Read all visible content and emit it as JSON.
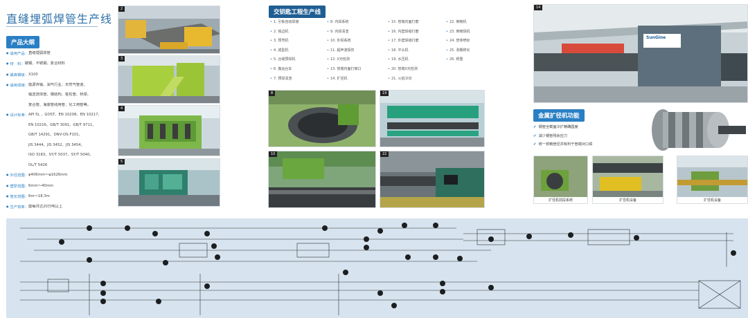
{
  "header": {
    "title": "直缝埋弧焊管生产线"
  },
  "product_overview": {
    "heading": "产品大纲",
    "specs": [
      {
        "label": "适用产品：",
        "lines": [
          "直缝埋弧焊管"
        ]
      },
      {
        "label": "材　料：",
        "lines": [
          "碳钢、不锈钢、复合材料"
        ]
      },
      {
        "label": "最高钢级：",
        "lines": [
          "X100"
        ]
      },
      {
        "label": "适用领域：",
        "lines": [
          "能源传输、油气行业、天然气管道、",
          "输送流体管、钢结构、桩柱管、桥梁、",
          "复合管、海底管线用管、化工用管等。"
        ]
      },
      {
        "label": "设计标准：",
        "lines": [
          "API 5L 、GOST、EN 10208、EN 10217、",
          "EN 10216、GB/T 3091、GB/T 9711、",
          "GB/T 14291、DNV-OS-F101、",
          "JIS 3444、JIS 3452、JIS 3454、",
          "ISO 3183、SY/T 5037、SY/T 5040、",
          "DL/T 5426"
        ]
      },
      {
        "label": "外径范围：",
        "lines": [
          "φ406mm～φ1626mm"
        ]
      },
      {
        "label": "壁厚范围：",
        "lines": [
          "6mm～40mm"
        ]
      },
      {
        "label": "管长范围：",
        "lines": [
          "6m～18.3m"
        ]
      },
      {
        "label": "生产效率：",
        "lines": [
          "能每月达20万吨以上"
        ]
      }
    ]
  },
  "process": {
    "heading": "交钥匙工程生产线",
    "steps": [
      "1. 引板自动焊接",
      "2. 铣边机",
      "3. 预弯机",
      "4. 成型机",
      "5. 合缝预焊机",
      "6. 搬运台车",
      "7. 预焊清渣",
      "8. 内焊系统",
      "9. 内焊清渣",
      "10. 外焊系统",
      "11. 超声波探伤",
      "12. X光检测",
      "13. 管端内面打坡口",
      "14. 扩径机",
      "15. 管端内面打磨",
      "16. 内壁焊缝打磨",
      "17. 外壁焊缝打磨",
      "18. 平头机",
      "19. 水压机",
      "20. 管端X光检测",
      "21. 火焰冷切",
      "22. 倒棱机",
      "23. 倒坡焊机",
      "24. 管体喷标",
      "25. 测量称长",
      "26. 称重"
    ]
  },
  "photos": {
    "p2": {
      "num": "2"
    },
    "p3": {
      "num": "3"
    },
    "p4": {
      "num": "4"
    },
    "p5": {
      "num": "5"
    },
    "p8": {
      "num": "8"
    },
    "p19": {
      "num": "19"
    },
    "p10": {
      "num": "10"
    },
    "p22": {
      "num": "22"
    },
    "p14": {
      "num": "14",
      "logo": "SunGine"
    }
  },
  "expander": {
    "heading": "金属扩径机功能",
    "features": [
      "钢管全截面冷扩精确圆度",
      "减少钢管残余应力",
      "统一校精管径并有利于管端对口焊"
    ],
    "captions": [
      "扩径机前段系统",
      "扩径机设备",
      "扩径机设备"
    ]
  }
}
